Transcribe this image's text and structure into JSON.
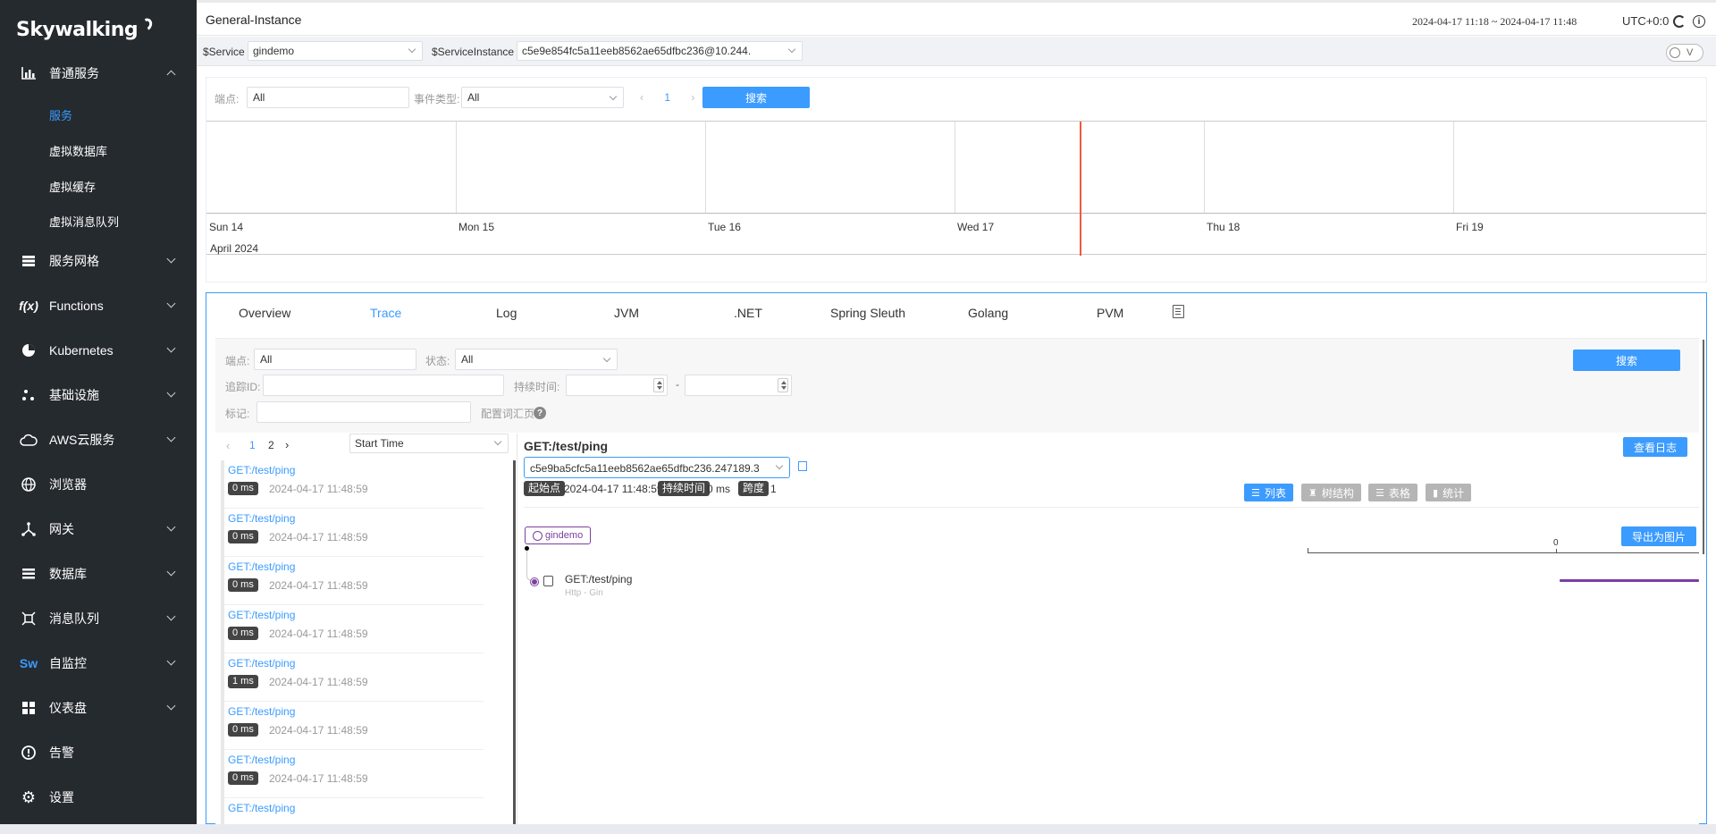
{
  "logo": {
    "text": "Skywalking"
  },
  "sidebar": {
    "items": [
      {
        "label": "普通服务",
        "icon": "bar-chart-icon",
        "expanded": true
      },
      {
        "label": "服务网格",
        "icon": "layers-icon"
      },
      {
        "label": "Functions",
        "icon": "function-icon"
      },
      {
        "label": "Kubernetes",
        "icon": "pie-icon"
      },
      {
        "label": "基础设施",
        "icon": "dots-icon"
      },
      {
        "label": "AWS云服务",
        "icon": "cloud-icon"
      },
      {
        "label": "浏览器",
        "icon": "globe-icon",
        "no_chevron": true
      },
      {
        "label": "网关",
        "icon": "gateway-icon"
      },
      {
        "label": "数据库",
        "icon": "list-icon"
      },
      {
        "label": "消息队列",
        "icon": "queue-icon"
      },
      {
        "label": "自监控",
        "icon": "sw-icon"
      },
      {
        "label": "仪表盘",
        "icon": "dashboard-icon"
      },
      {
        "label": "告警",
        "icon": "alarm-icon",
        "no_chevron": true
      },
      {
        "label": "设置",
        "icon": "gear-icon",
        "no_chevron": true
      }
    ],
    "sub_items": [
      {
        "label": "服务",
        "active": true
      },
      {
        "label": "虚拟数据库"
      },
      {
        "label": "虚拟缓存"
      },
      {
        "label": "虚拟消息队列"
      }
    ]
  },
  "header": {
    "title": "General-Instance",
    "time_range": "2024-04-17 11:18 ~ 2024-04-17 11:48",
    "timezone": "UTC+0:0"
  },
  "selectors": {
    "service_label": "$Service",
    "service_value": "gindemo",
    "instance_label": "$ServiceInstance",
    "instance_value": "c5e9e854fc5a11eeb8562ae65dfbc236@10.244.",
    "toggle_label": "V"
  },
  "events": {
    "endpoint_label": "端点:",
    "endpoint_value": "All",
    "event_type_label": "事件类型:",
    "event_type_value": "All",
    "page": "1",
    "search_label": "搜索",
    "days": [
      "Sun 14",
      "Mon 15",
      "Tue 16",
      "Wed 17",
      "Thu 18",
      "Fri 19"
    ],
    "month": "April 2024"
  },
  "tabs": [
    {
      "label": "Overview"
    },
    {
      "label": "Trace",
      "active": true
    },
    {
      "label": "Log"
    },
    {
      "label": "JVM"
    },
    {
      "label": ".NET"
    },
    {
      "label": "Spring Sleuth"
    },
    {
      "label": "Golang"
    },
    {
      "label": "PVM"
    }
  ],
  "trace_filters": {
    "endpoint_label": "端点:",
    "endpoint_value": "All",
    "status_label": "状态:",
    "status_value": "All",
    "trace_id_label": "追踪ID:",
    "duration_label": "持续时间:",
    "duration_sep": "-",
    "tags_label": "标记:",
    "config_label": "配置词汇页",
    "help_glyph": "?",
    "search_label": "搜索"
  },
  "trace_list": {
    "pages": [
      "1",
      "2"
    ],
    "sort_value": "Start Time",
    "entries": [
      {
        "endpoint": "GET:/test/ping",
        "duration": "0 ms",
        "time": "2024-04-17 11:48:59"
      },
      {
        "endpoint": "GET:/test/ping",
        "duration": "0 ms",
        "time": "2024-04-17 11:48:59"
      },
      {
        "endpoint": "GET:/test/ping",
        "duration": "0 ms",
        "time": "2024-04-17 11:48:59"
      },
      {
        "endpoint": "GET:/test/ping",
        "duration": "0 ms",
        "time": "2024-04-17 11:48:59"
      },
      {
        "endpoint": "GET:/test/ping",
        "duration": "1 ms",
        "time": "2024-04-17 11:48:59"
      },
      {
        "endpoint": "GET:/test/ping",
        "duration": "0 ms",
        "time": "2024-04-17 11:48:59"
      },
      {
        "endpoint": "GET:/test/ping",
        "duration": "0 ms",
        "time": "2024-04-17 11:48:59"
      },
      {
        "endpoint": "GET:/test/ping",
        "duration": "",
        "time": ""
      }
    ]
  },
  "detail": {
    "title": "GET:/test/ping",
    "view_logs": "查看日志",
    "trace_id": "c5e9ba5cfc5a11eeb8562ae65dfbc236.247189.3",
    "start_label": "起始点",
    "start_value": "2024-04-17 11:48:59",
    "duration_label": "持续时间",
    "duration_value": "0 ms",
    "spans_label": "跨度",
    "spans_value": "1",
    "views": [
      {
        "label": "列表",
        "glyph": "☰",
        "active": true
      },
      {
        "label": "树结构",
        "glyph": "♜"
      },
      {
        "label": "表格",
        "glyph": "☰"
      },
      {
        "label": "统计",
        "glyph": "▮"
      }
    ],
    "service_chip": "gindemo",
    "export_label": "导出为图片",
    "axis_zero": "0",
    "span_name": "GET:/test/ping",
    "span_component": "Http - Gin"
  },
  "colors": {
    "accent": "#3b9bff",
    "sidebar": "#252a2f",
    "span": "#7b3fa0",
    "now_line": "#f25a3a"
  }
}
